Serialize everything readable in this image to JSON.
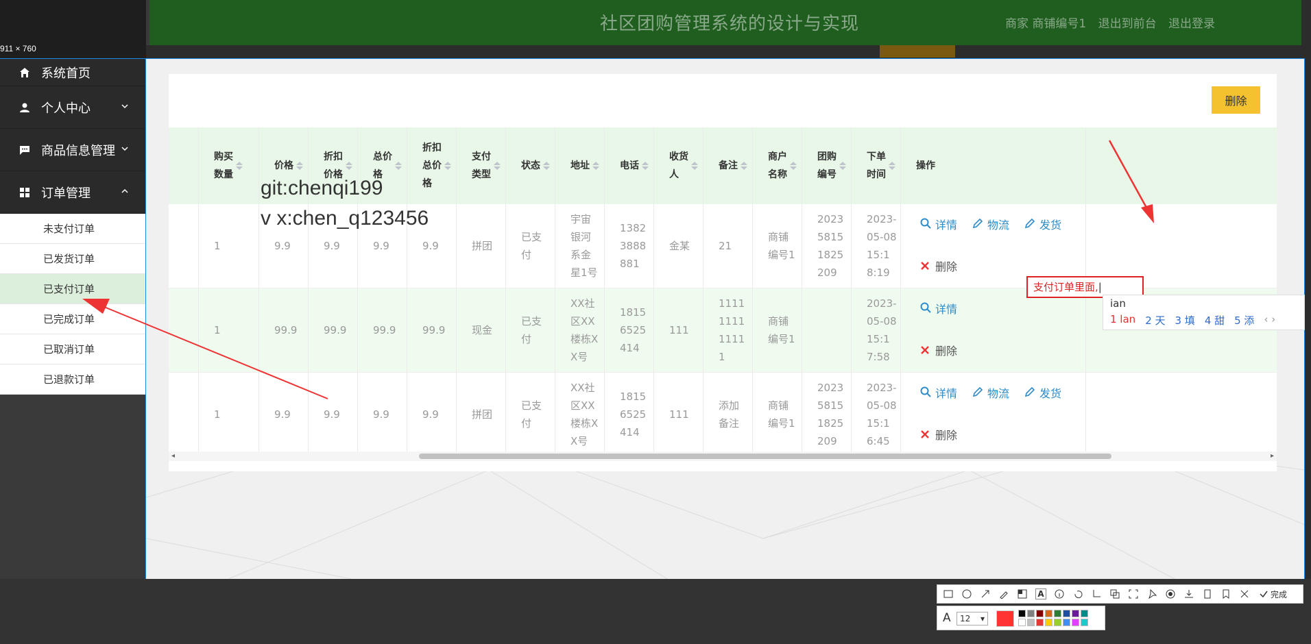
{
  "screen": {
    "dimension_label": "911 × 760"
  },
  "header": {
    "title": "社区团购管理系统的设计与实现",
    "links": [
      "商家 商铺编号1",
      "退出到前台",
      "退出登录"
    ]
  },
  "sidebar": {
    "items": [
      {
        "label": "系统首页",
        "icon": "home-icon"
      },
      {
        "label": "个人中心",
        "icon": "user-icon"
      },
      {
        "label": "商品信息管理",
        "icon": "message-icon"
      },
      {
        "label": "订单管理",
        "icon": "grid-icon"
      }
    ],
    "submenu": [
      "未支付订单",
      "已发货订单",
      "已支付订单",
      "已完成订单",
      "已取消订单",
      "已退款订单"
    ],
    "active_sub": "已支付订单"
  },
  "toolbar": {
    "delete_label": "删除"
  },
  "table": {
    "columns": [
      "购买\n数量",
      "价格",
      "折扣\n价格",
      "总价\n格",
      "折扣\n总价\n格",
      "支付\n类型",
      "状态",
      "地址",
      "电话",
      "收货\n人",
      "备注",
      "商户\n名称",
      "团购\n编号",
      "下单\n时间",
      "操作"
    ],
    "rows": [
      [
        "1",
        "9.9",
        "9.9",
        "9.9",
        "9.9",
        "拼团",
        "已支\n付",
        "宇宙\n银河\n系金\n星1号",
        "1382\n3888\n881",
        "金某",
        "21",
        "商铺\n编号1",
        "2023\n5815\n1825\n209",
        "2023-\n05-08\n15:1\n8:19"
      ],
      [
        "1",
        "99.9",
        "99.9",
        "99.9",
        "99.9",
        "现金",
        "已支\n付",
        "XX社\n区XX\n楼栋X\nX号",
        "1815\n6525\n414",
        "111",
        "1111\n1111\n1111\n1",
        "商铺\n编号1",
        "",
        "2023-\n05-08\n15:1\n7:58"
      ],
      [
        "1",
        "9.9",
        "9.9",
        "9.9",
        "9.9",
        "拼团",
        "已支\n付",
        "XX社\n区XX\n楼栋X\nX号",
        "1815\n6525\n414",
        "111",
        "添加\n备注",
        "商铺\n编号1",
        "2023\n5815\n1825\n209",
        "2023-\n05-08\n15:1\n6:45"
      ]
    ],
    "ops": {
      "detail": "详情",
      "logistics": "物流",
      "ship": "发货",
      "delete": "删除"
    }
  },
  "watermark": {
    "line1": "git:chenqi199",
    "line2": "v x:chen_q123456"
  },
  "annotation": {
    "text": "支付订单里面,",
    "ime_composition": "ian",
    "ime_candidates": [
      "1 lan",
      "2 天",
      "3 填",
      "4 甜",
      "5 添"
    ]
  },
  "snip_toolbar": {
    "done_label": "完成",
    "font_size": "12"
  },
  "colors": {
    "header_bg": "#1f5e1f",
    "accent_green": "#e8f7e8",
    "delete_btn": "#f3c22e",
    "link_blue": "#2e8bc9",
    "arrow_red": "#e33"
  }
}
